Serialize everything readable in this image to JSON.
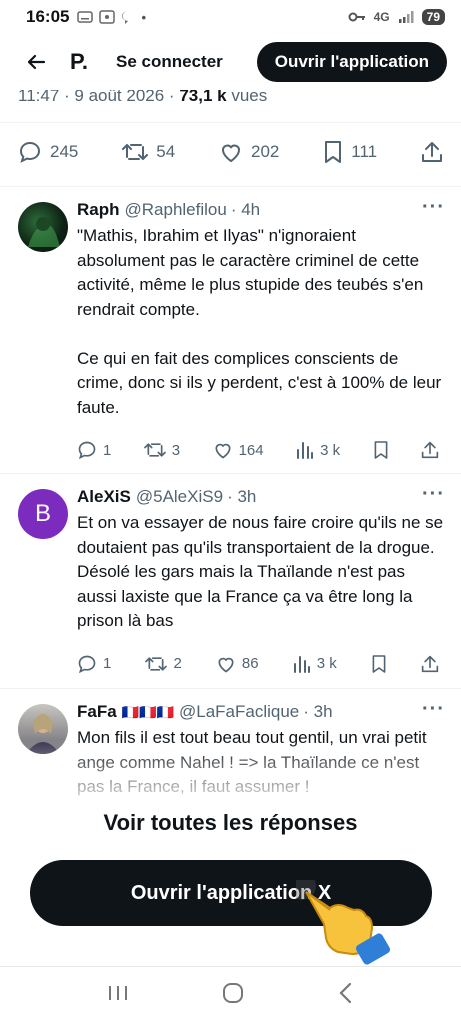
{
  "status_bar": {
    "time": "16:05",
    "network": "4G",
    "battery": "79"
  },
  "header": {
    "logo_fragment": "P.",
    "connect_label": "Se connecter",
    "open_app_label": "Ouvrir l'application"
  },
  "post_meta": {
    "time": "11:47",
    "date": "9 août 2026",
    "views_count": "73,1 k",
    "views_label": "vues"
  },
  "post_stats": {
    "replies": "245",
    "reposts": "54",
    "likes": "202",
    "bookmarks": "111"
  },
  "replies": [
    {
      "name": "Raph",
      "handle": "@Raphlefilou",
      "time": "· 4h",
      "text": "\"Mathis, Ibrahim et Ilyas\" n'ignoraient absolument pas le caractère criminel de cette activité, même le plus stupide des teubés s'en rendrait compte.\n\nCe qui en fait des complices conscients de crime, donc si ils y perdent, c'est à 100% de leur faute.",
      "replies": "1",
      "reposts": "3",
      "likes": "164",
      "views": "3 k"
    },
    {
      "name": "AleXiS",
      "avatar_letter": "B",
      "handle": "@5AleXiS9",
      "time": "· 3h",
      "text": "Et on va essayer de nous faire croire qu'ils ne se doutaient pas qu'ils transportaient de la drogue. Désolé les gars mais la Thaïlande n'est pas aussi laxiste que la France ça va être long la prison là bas",
      "replies": "1",
      "reposts": "2",
      "likes": "86",
      "views": "3 k"
    },
    {
      "name": "FaFa",
      "flags": "🇫🇷🇫🇷🇫🇷",
      "handle": "@LaFaFaclique",
      "time": "· 3h",
      "text": "Mon fils il est tout beau tout gentil, un vrai petit ange comme Nahel ! => la Thaïlande ce n'est pas la France, il faut assumer !"
    }
  ],
  "see_all_label": "Voir toutes les réponses",
  "open_app_bottom_label": "Ouvrir l'application X",
  "colors": {
    "text": "#0f1419",
    "secondary": "#536471",
    "button_bg": "#0f1419",
    "alexis_avatar": "#7b2cbf"
  }
}
